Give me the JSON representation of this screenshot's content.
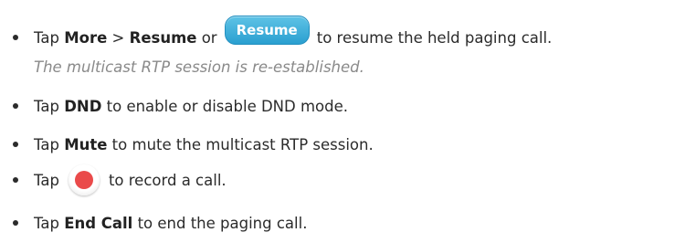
{
  "items": [
    {
      "t1": "Tap ",
      "b1": "More",
      "t2": " > ",
      "b2": "Resume",
      "t3": " or",
      "button_label": "Resume",
      "t4": "to resume the held paging call."
    },
    {
      "note": "The multicast RTP session is re-established."
    },
    {
      "t1": "Tap ",
      "b1": "DND",
      "t2": " to enable or disable DND mode."
    },
    {
      "t1": "Tap ",
      "b1": "Mute",
      "t2": " to mute the multicast RTP session."
    },
    {
      "t1": "Tap",
      "icon": "record-icon",
      "t2": "to record a call."
    },
    {
      "t1": "Tap ",
      "b1": "End Call",
      "t2": " to end the paging call."
    }
  ],
  "colors": {
    "text": "#2b2b2b",
    "note": "#8a8a8a",
    "resume_button": "#2a9fd0",
    "record_dot": "#ea4a4a"
  }
}
